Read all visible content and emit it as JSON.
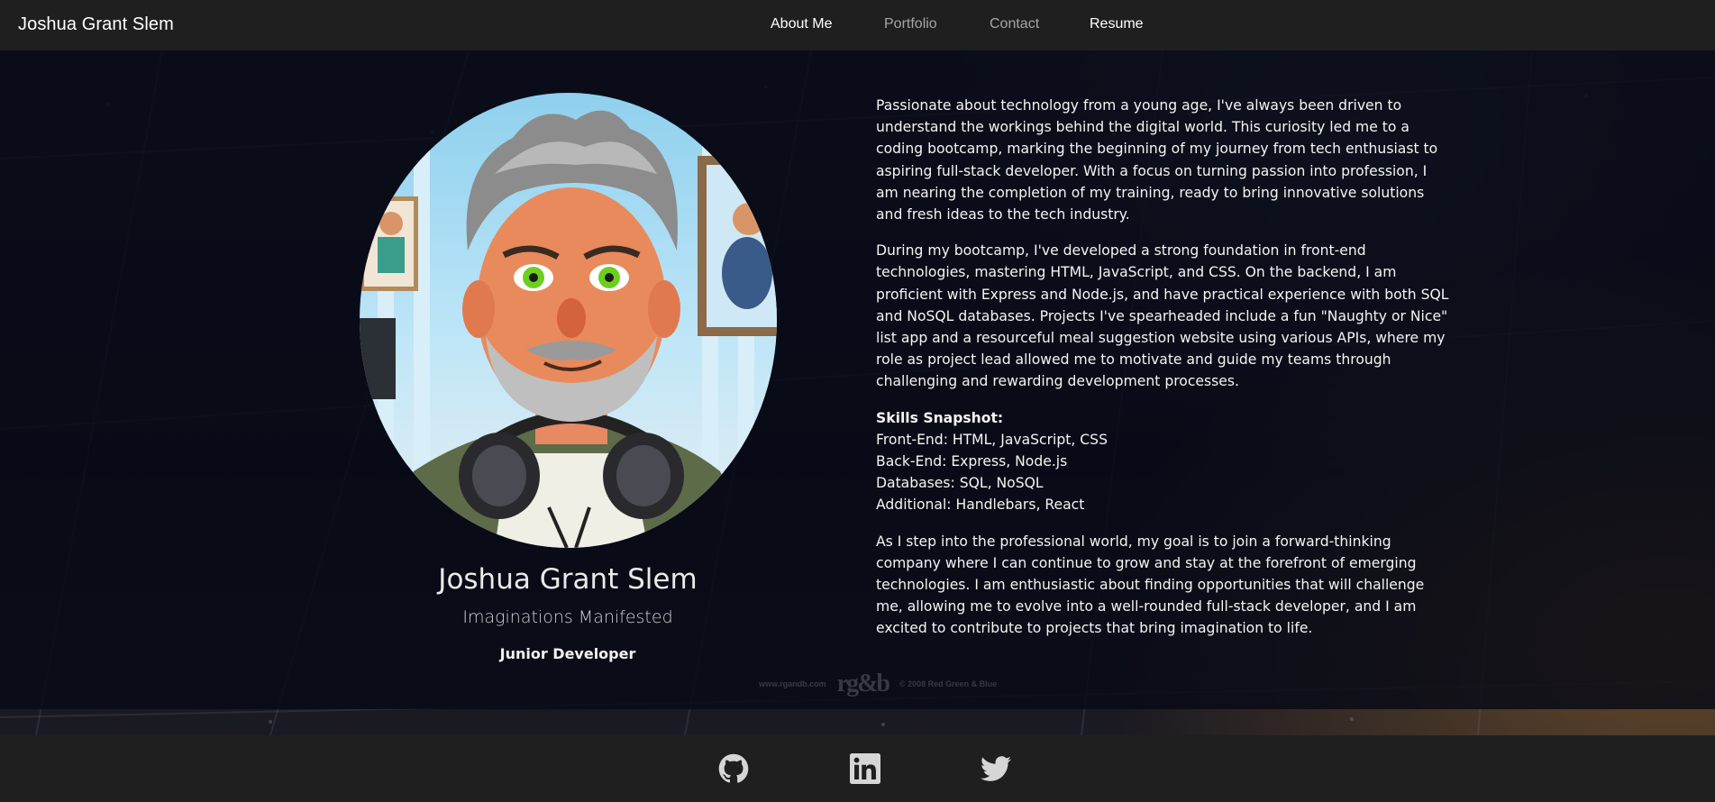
{
  "navbar": {
    "brand": "Joshua Grant Slem",
    "links": [
      {
        "label": "About Me"
      },
      {
        "label": "Portfolio"
      },
      {
        "label": "Contact"
      },
      {
        "label": "Resume"
      }
    ]
  },
  "profile": {
    "name": "Joshua Grant Slem",
    "tagline": "Imaginations Manifested",
    "role": "Junior Developer"
  },
  "bio": {
    "p1": "Passionate about technology from a young age, I've always been driven to understand the workings behind the digital world. This curiosity led me to a coding bootcamp, marking the beginning of my journey from tech enthusiast to aspiring full-stack developer. With a focus on turning passion into profession, I am nearing the completion of my training, ready to bring innovative solutions and fresh ideas to the tech industry.",
    "p2": "During my bootcamp, I've developed a strong foundation in front-end technologies, mastering HTML, JavaScript, and CSS. On the backend, I am proficient with Express and Node.js, and have practical experience with both SQL and NoSQL databases. Projects I've spearheaded include a fun \"Naughty or Nice\" list app and a resourceful meal suggestion website using various APIs, where my role as project lead allowed me to motivate and guide my teams through challenging and rewarding development processes.",
    "skills_title": "Skills Snapshot:",
    "skills": [
      "Front-End: HTML, JavaScript, CSS",
      "Back-End: Express, Node.js",
      "Databases: SQL, NoSQL",
      "Additional: Handlebars, React"
    ],
    "p3": "As I step into the professional world, my goal is to join a forward-thinking company where I can continue to grow and stay at the forefront of emerging technologies. I am enthusiastic about finding opportunities that will challenge me, allowing me to evolve into a well-rounded full-stack developer, and I am excited to contribute to projects that bring imagination to life."
  },
  "watermark": {
    "left": "www.rgandb.com",
    "logo": "rg&b",
    "right": "© 2008 Red Green & Blue"
  },
  "footer": {
    "icons": [
      "github-icon",
      "linkedin-icon",
      "twitter-icon"
    ]
  },
  "colors": {
    "navbar": "#1f1f1f",
    "panel": "#070a16",
    "text": "#f4f4f4",
    "nav_dim": "#a6a6a6"
  }
}
